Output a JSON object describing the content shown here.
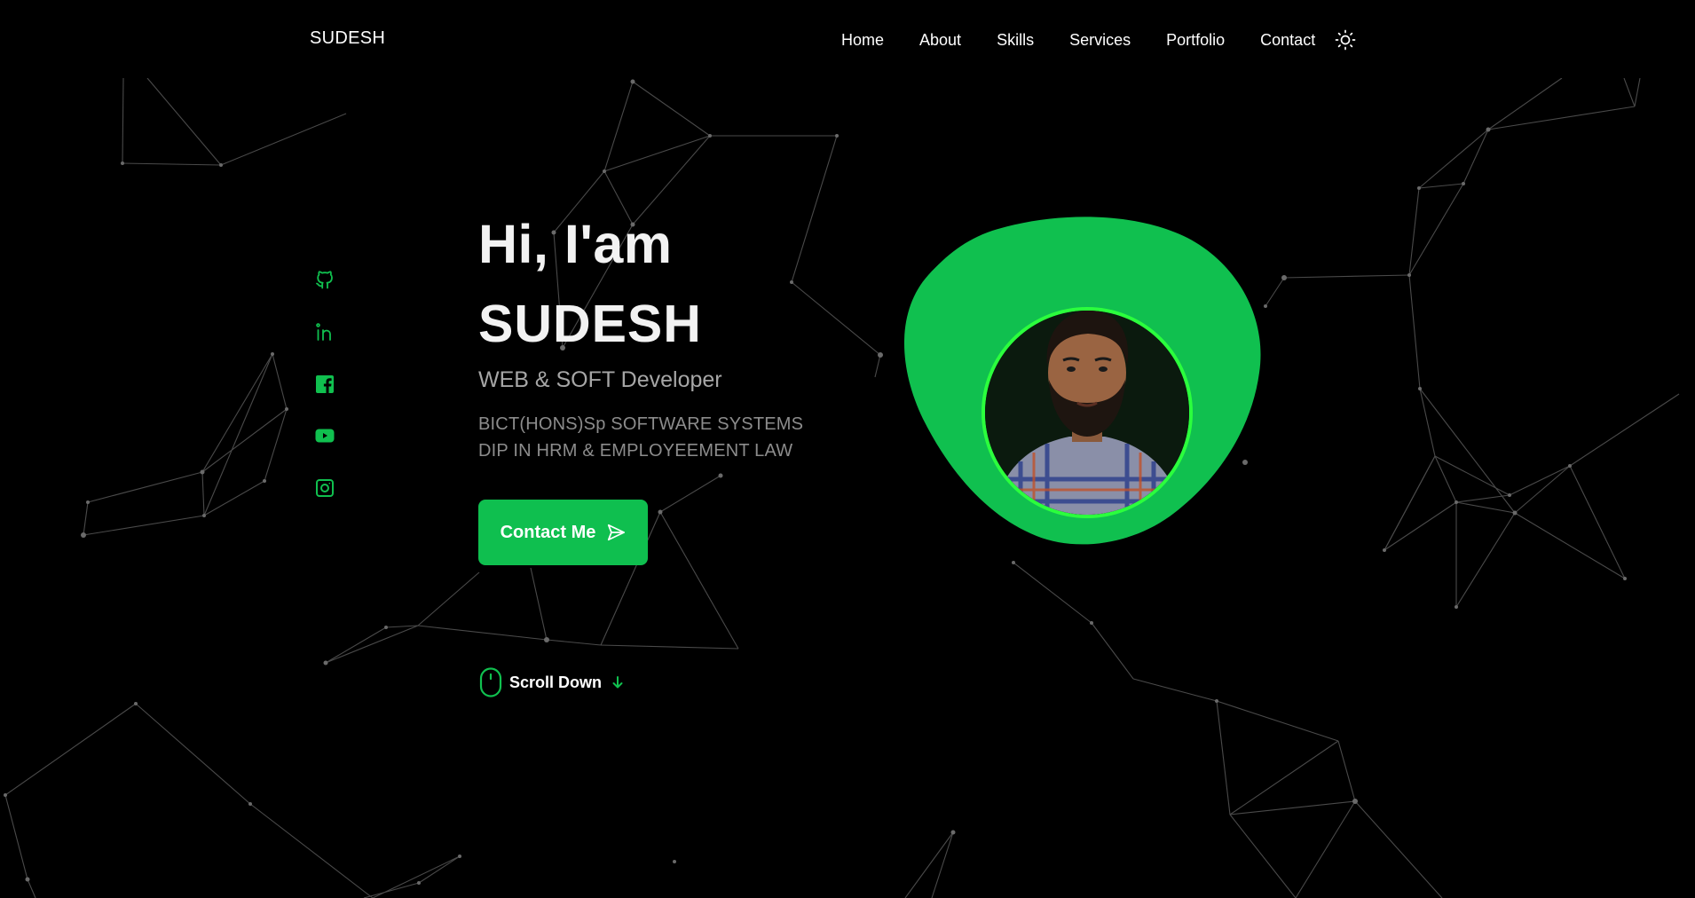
{
  "header": {
    "logo": "SUDESH",
    "nav": [
      {
        "label": "Home"
      },
      {
        "label": "About"
      },
      {
        "label": "Skills"
      },
      {
        "label": "Services"
      },
      {
        "label": "Portfolio"
      },
      {
        "label": "Contact"
      }
    ],
    "theme_icon": "sun-icon"
  },
  "social": [
    {
      "icon": "github-icon"
    },
    {
      "icon": "linkedin-icon"
    },
    {
      "icon": "facebook-icon"
    },
    {
      "icon": "youtube-icon"
    },
    {
      "icon": "instagram-icon"
    }
  ],
  "hero": {
    "greeting": "Hi, I'am",
    "name": "SUDESH",
    "role": "WEB & SOFT Developer",
    "qualifications": [
      "BICT(HONS)Sp SOFTWARE SYSTEMS",
      "DIP IN HRM & EMPLOYEEMENT LAW"
    ],
    "contact_button": "Contact Me",
    "contact_icon": "send-icon",
    "scroll_label": "Scroll Down",
    "scroll_icon": "mouse-icon",
    "scroll_arrow_icon": "arrow-down-icon"
  },
  "profile": {
    "image": "profile-photo"
  },
  "colors": {
    "accent": "#10c04f",
    "background": "#000000",
    "ring": "#2bff3d"
  }
}
